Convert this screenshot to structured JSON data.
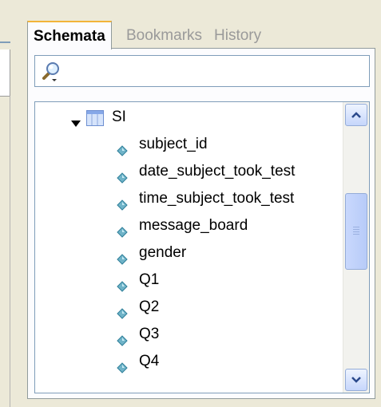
{
  "tabs": [
    {
      "label": "Schemata",
      "active": true
    },
    {
      "label": "Bookmarks",
      "active": false
    },
    {
      "label": "History",
      "active": false
    }
  ],
  "search": {
    "value": "",
    "placeholder": "",
    "icon": "magnifier-icon"
  },
  "tree": {
    "root": {
      "label": "SI",
      "expanded": true,
      "icon": "table-icon"
    },
    "fields": [
      "subject_id",
      "date_subject_took_test",
      "time_subject_took_test",
      "message_board",
      "gender",
      "Q1",
      "Q2",
      "Q3",
      "Q4"
    ],
    "field_icon": "column-diamond-icon"
  },
  "colors": {
    "active_tab_accent": "#f2b43a",
    "panel_border": "#919b9c",
    "field_border": "#7f9db9",
    "diamond": "#6fb3c8"
  },
  "scrollbar": {
    "position": 0.4
  }
}
